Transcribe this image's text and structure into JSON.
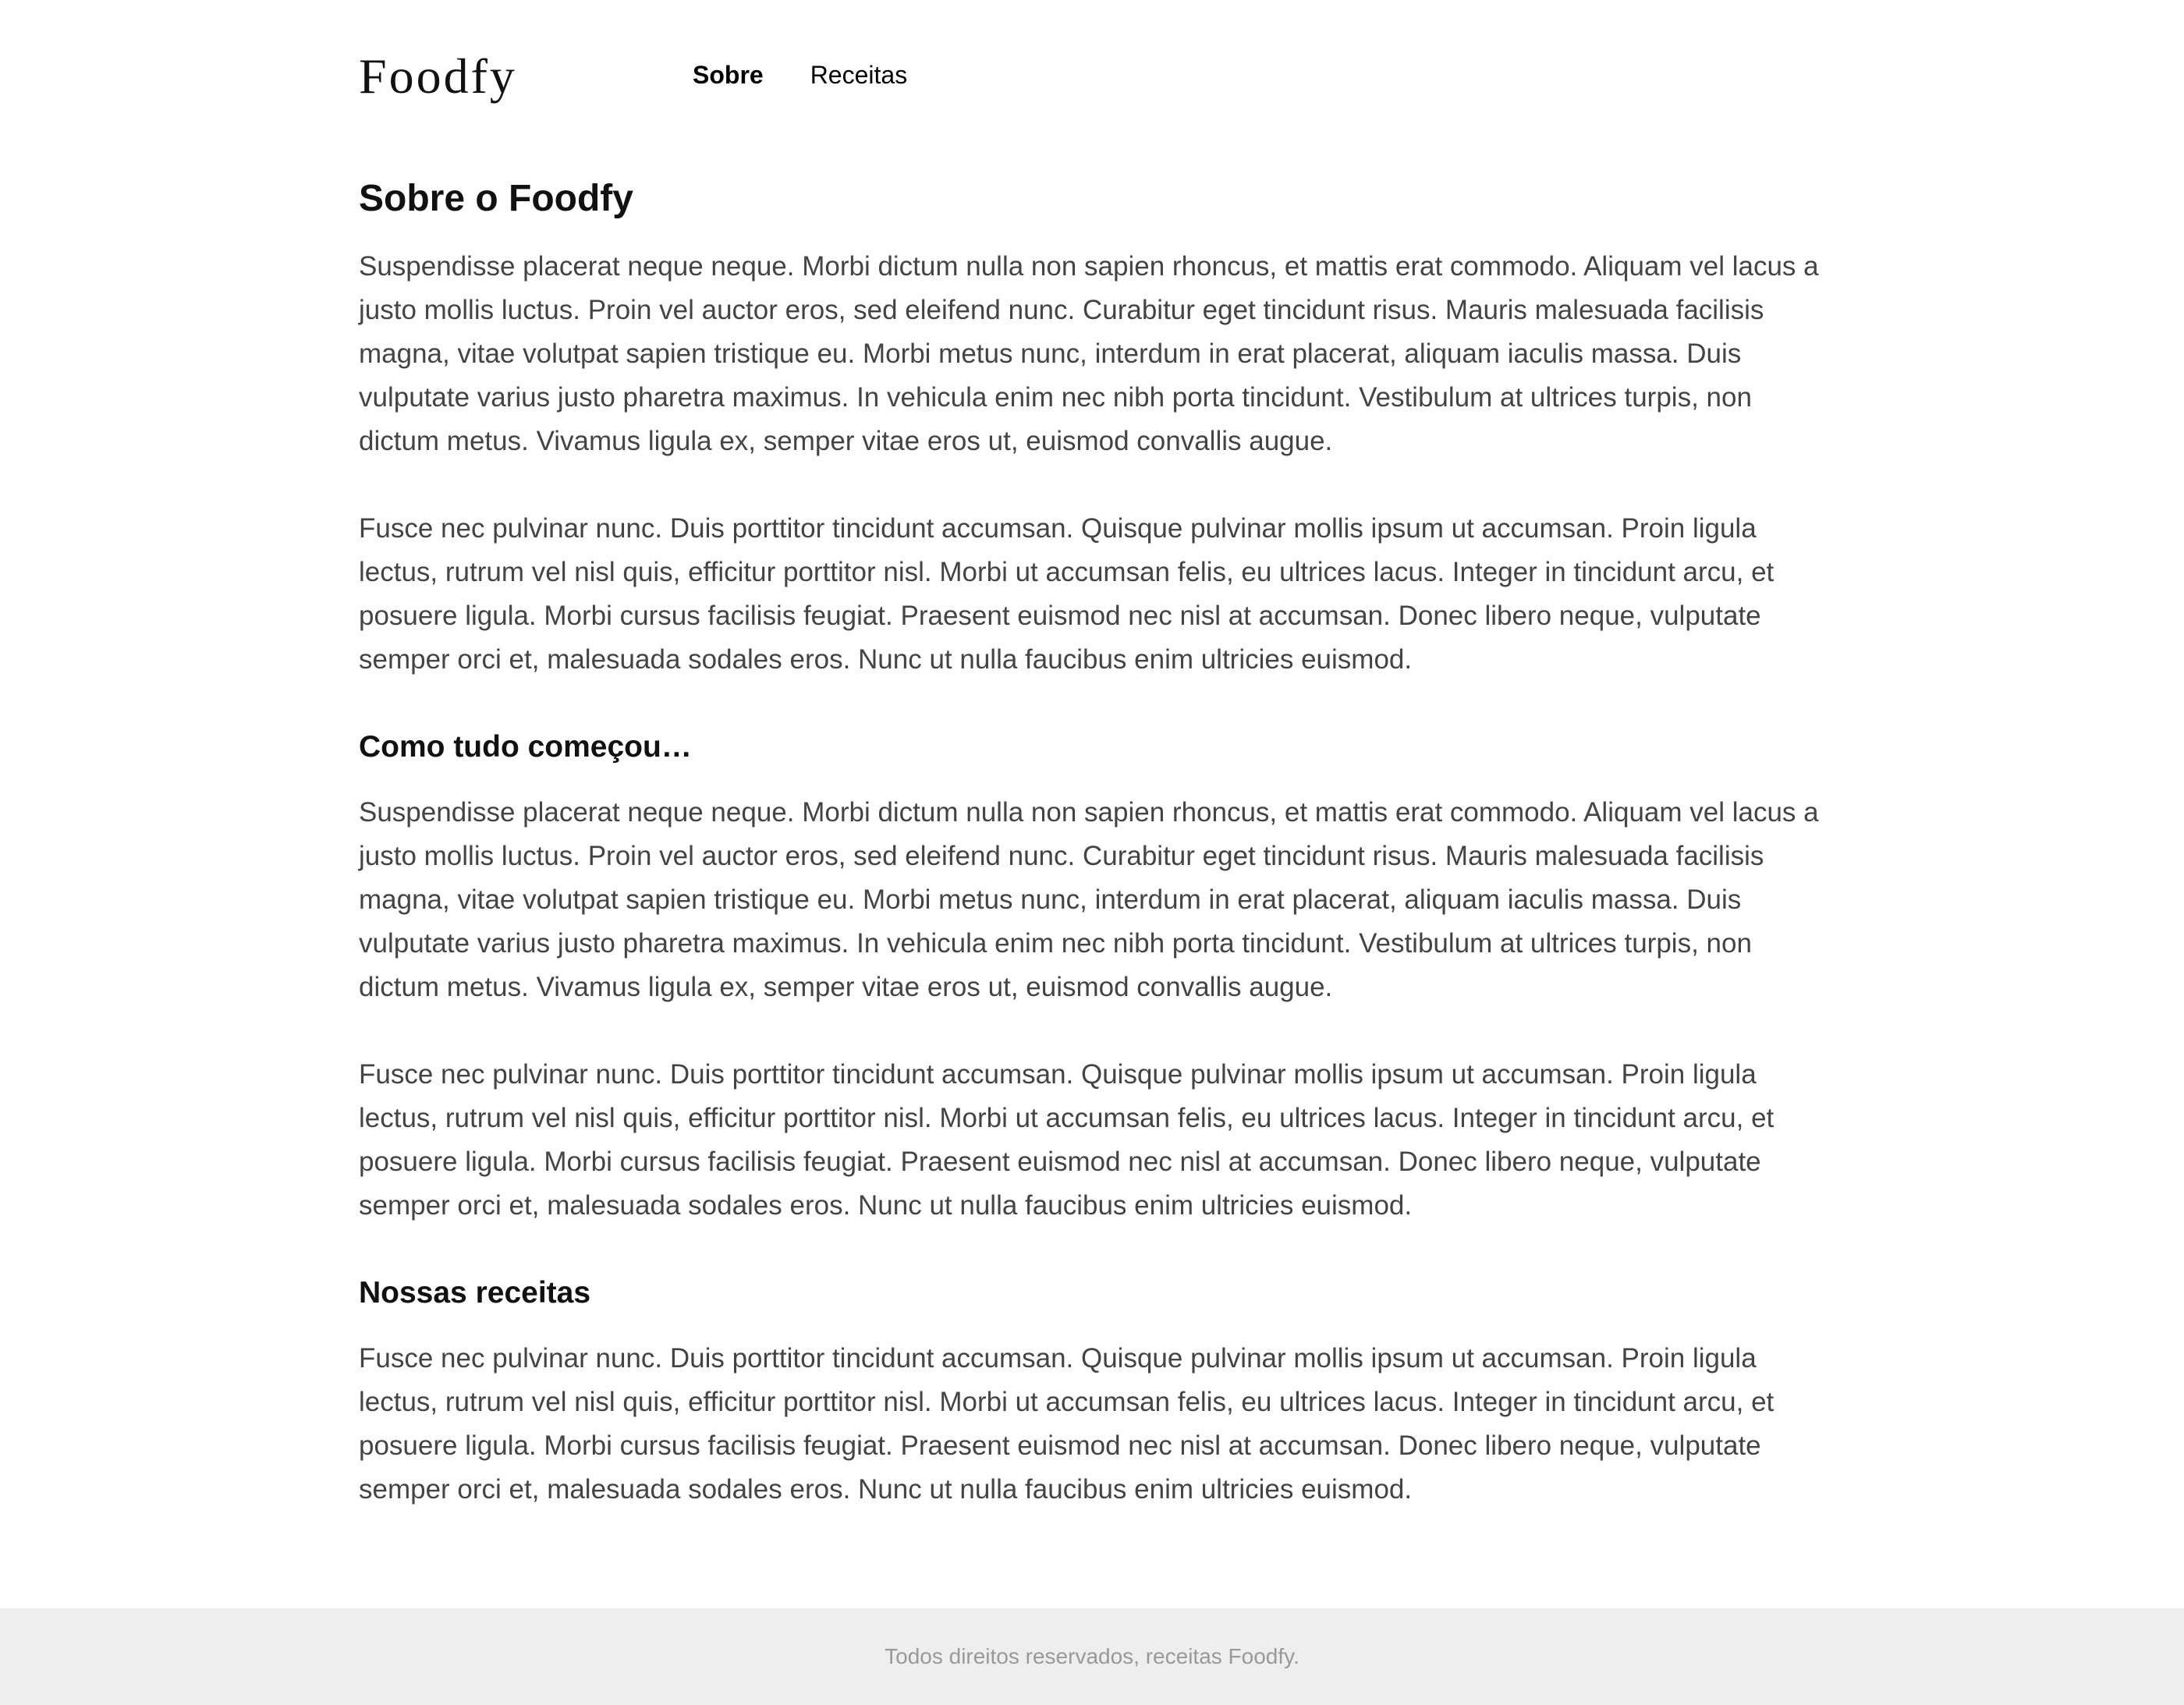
{
  "header": {
    "logo": "Foodfy",
    "nav": {
      "about": "Sobre",
      "recipes": "Receitas"
    }
  },
  "main": {
    "title": "Sobre o Foodfy",
    "intro_paragraph_1": "Suspendisse placerat neque neque. Morbi dictum nulla non sapien rhoncus, et mattis erat commodo. Aliquam vel lacus a justo mollis luctus. Proin vel auctor eros, sed eleifend nunc. Curabitur eget tincidunt risus. Mauris malesuada facilisis magna, vitae volutpat sapien tristique eu. Morbi metus nunc, interdum in erat placerat, aliquam iaculis massa. Duis vulputate varius justo pharetra maximus. In vehicula enim nec nibh porta tincidunt. Vestibulum at ultrices turpis, non dictum metus. Vivamus ligula ex, semper vitae eros ut, euismod convallis augue.",
    "intro_paragraph_2": "Fusce nec pulvinar nunc. Duis porttitor tincidunt accumsan. Quisque pulvinar mollis ipsum ut accumsan. Proin ligula lectus, rutrum vel nisl quis, efficitur porttitor nisl. Morbi ut accumsan felis, eu ultrices lacus. Integer in tincidunt arcu, et posuere ligula. Morbi cursus facilisis feugiat. Praesent euismod nec nisl at accumsan. Donec libero neque, vulputate semper orci et, malesuada sodales eros. Nunc ut nulla faucibus enim ultricies euismod.",
    "history_heading": "Como tudo começou…",
    "history_paragraph_1": "Suspendisse placerat neque neque. Morbi dictum nulla non sapien rhoncus, et mattis erat commodo. Aliquam vel lacus a justo mollis luctus. Proin vel auctor eros, sed eleifend nunc. Curabitur eget tincidunt risus. Mauris malesuada facilisis magna, vitae volutpat sapien tristique eu. Morbi metus nunc, interdum in erat placerat, aliquam iaculis massa. Duis vulputate varius justo pharetra maximus. In vehicula enim nec nibh porta tincidunt. Vestibulum at ultrices turpis, non dictum metus. Vivamus ligula ex, semper vitae eros ut, euismod convallis augue.",
    "history_paragraph_2": "Fusce nec pulvinar nunc. Duis porttitor tincidunt accumsan. Quisque pulvinar mollis ipsum ut accumsan. Proin ligula lectus, rutrum vel nisl quis, efficitur porttitor nisl. Morbi ut accumsan felis, eu ultrices lacus. Integer in tincidunt arcu, et posuere ligula. Morbi cursus facilisis feugiat. Praesent euismod nec nisl at accumsan. Donec libero neque, vulputate semper orci et, malesuada sodales eros. Nunc ut nulla faucibus enim ultricies euismod.",
    "recipes_heading": "Nossas receitas",
    "recipes_paragraph": "Fusce nec pulvinar nunc. Duis porttitor tincidunt accumsan. Quisque pulvinar mollis ipsum ut accumsan. Proin ligula lectus, rutrum vel nisl quis, efficitur porttitor nisl. Morbi ut accumsan felis, eu ultrices lacus. Integer in tincidunt arcu, et posuere ligula. Morbi cursus facilisis feugiat. Praesent euismod nec nisl at accumsan. Donec libero neque, vulputate semper orci et, malesuada sodales eros. Nunc ut nulla faucibus enim ultricies euismod."
  },
  "footer": {
    "text": "Todos direitos reservados, receitas Foodfy."
  },
  "colors": {
    "heading": "#111111",
    "body_text": "#444444",
    "footer_bg": "#eeeeee",
    "footer_text": "#999999"
  }
}
